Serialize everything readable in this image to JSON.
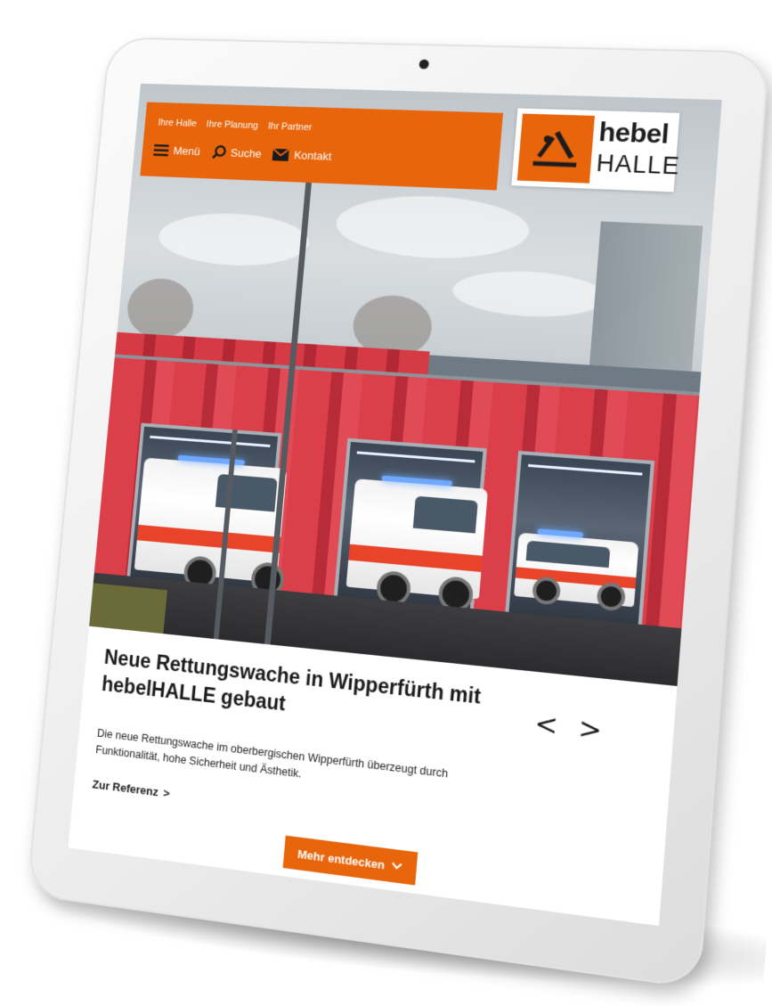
{
  "nav": {
    "top_links": [
      "Ihre Halle",
      "Ihre Planung",
      "Ihr Partner"
    ],
    "menu_label": "Menü",
    "search_label": "Suche",
    "contact_label": "Kontakt"
  },
  "logo": {
    "line1": "hebel",
    "line2": "HALLE"
  },
  "article": {
    "headline": "Neue Rettungswache in Wipperfürth mit hebelHALLE gebaut",
    "description": "Die neue Rettungswache im oberbergischen Wipperfürth überzeugt durch Funktionalität, hohe Sicherheit und Ästhetik.",
    "link_label": "Zur Referenz",
    "link_arrow": ">",
    "prev_arrow": "<",
    "next_arrow": ">"
  },
  "cta": {
    "label": "Mehr entdecken"
  },
  "icons": {
    "menu": "hamburger-icon",
    "search": "magnifier-icon",
    "contact": "envelope-icon",
    "cta": "chevron-down-icon",
    "logo": "hebel-logo-mark"
  },
  "colors": {
    "brand_orange": "#e8650c",
    "text": "#1a1a1a",
    "background": "#ffffff"
  }
}
